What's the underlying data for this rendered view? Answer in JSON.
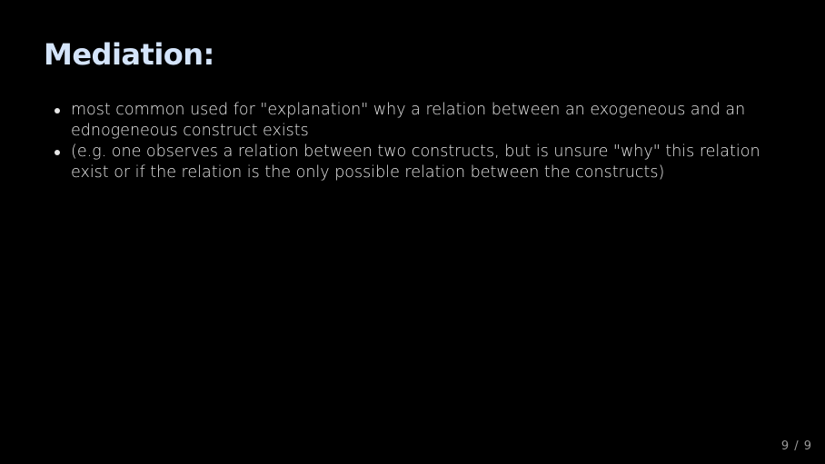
{
  "slide": {
    "title": "Mediation:",
    "bullets": [
      "most common used for \"explanation\" why a relation between an exogeneous and an ednogeneous construct exists",
      "(e.g. one observes a relation between two constructs, but is unsure \"why\" this relation exist or if the relation is the only possible relation between the constructs)"
    ],
    "page_number": "9 / 9"
  },
  "colors": {
    "background": "#000000",
    "title": "#d4e4fa",
    "body_text": "#e6e6e6",
    "page_number": "#9a9a9a"
  }
}
